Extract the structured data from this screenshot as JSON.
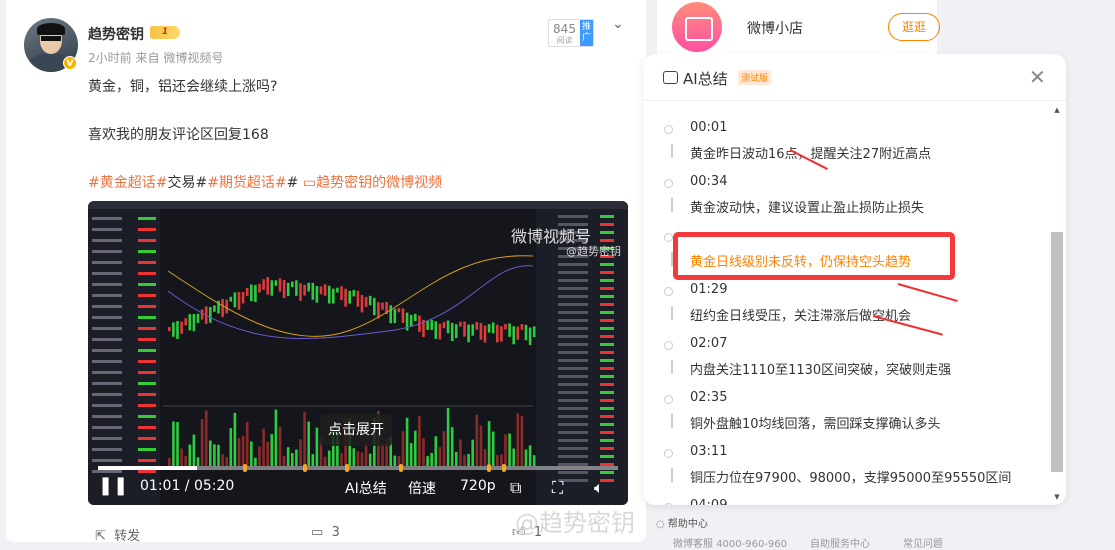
{
  "post": {
    "username": "趋势密钥",
    "level": "1",
    "verified": "V",
    "time": "2小时前",
    "source_prefix": "来自",
    "source": "微博视频号",
    "reads": "845",
    "reads_label": "阅读",
    "promote": "推广",
    "line1": "黄金，铜，铝还会继续上涨吗?",
    "line2": "喜欢我的朋友评论区回复168",
    "tag1": "#黄金超话#",
    "plain1": "交易#",
    "tag2": "#期货超话#",
    "plain2": "# ",
    "video_link": "趋势密钥的微博视频"
  },
  "video": {
    "watermark": "微博视频号",
    "watermark_user": "@趋势密钥",
    "expand": "点击展开",
    "current": "01:01",
    "duration": "05:20",
    "progress": 0.19,
    "ai_btn": "AI总结",
    "speed": "倍速",
    "quality": "720p"
  },
  "actions": {
    "repost": "转发",
    "comments": "3",
    "likes": "1"
  },
  "shop": {
    "name": "微博小店",
    "button": "逛逛"
  },
  "ai": {
    "title": "AI总结",
    "beta": "测试版",
    "items": [
      {
        "time": "00:01",
        "text": "黄金昨日波动16点，提醒关注27附近高点"
      },
      {
        "time": "00:34",
        "text": "黄金波动快，建议设置止盈止损防止损失"
      },
      {
        "time": "",
        "text": "黄金日线级别未反转，仍保持空头趋势"
      },
      {
        "time": "01:29",
        "text": "纽约金日线受压，关注滞涨后做空机会"
      },
      {
        "time": "02:07",
        "text": "内盘关注1110至1130区间突破，突破则走强"
      },
      {
        "time": "02:35",
        "text": "铜外盘触10均线回落，需回踩支撑确认多头"
      },
      {
        "time": "03:11",
        "text": "铜压力位在97900、98000，支撑95000至95550区间"
      },
      {
        "time": "04:09",
        "text": ""
      }
    ]
  },
  "footer": {
    "help": "帮助中心",
    "service": "微博客服 4000-960-960",
    "self": "自助服务中心",
    "faq": "常见问题"
  },
  "watermark": "@趋势密钥"
}
